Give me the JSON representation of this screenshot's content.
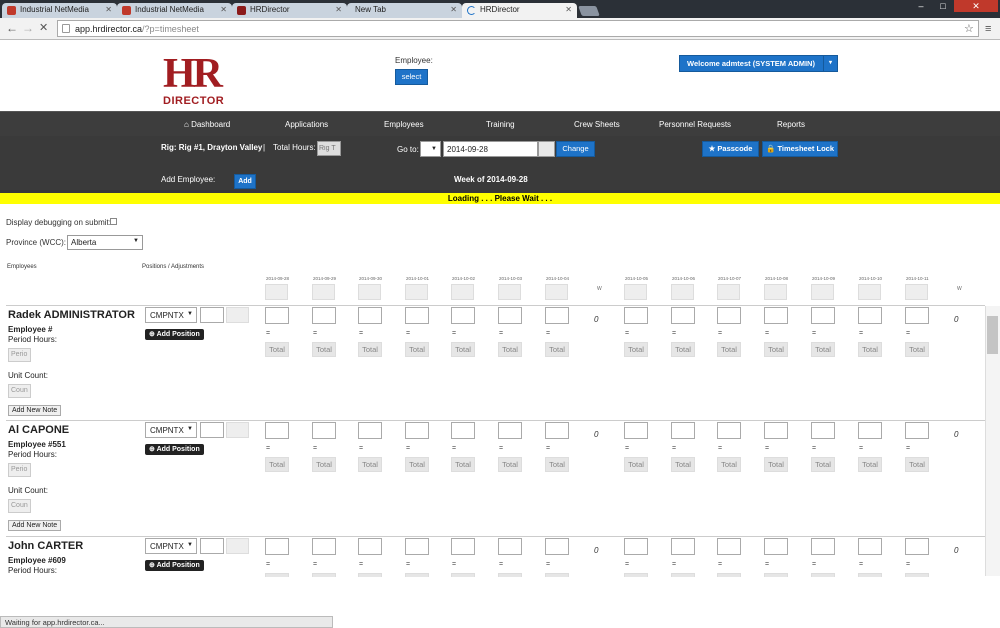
{
  "browser": {
    "tabs": [
      {
        "label": "Industrial NetMedia",
        "icon_color": "#c0392b"
      },
      {
        "label": "Industrial NetMedia",
        "icon_color": "#c0392b"
      },
      {
        "label": "HRDirector",
        "icon_color": "#8b1a1a"
      },
      {
        "label": "New Tab",
        "icon_color": ""
      },
      {
        "label": "HRDirector",
        "icon_color": "#1e73c8"
      }
    ],
    "url_host": "app.hrdirector.ca",
    "url_path": "/?p=timesheet",
    "status": "Waiting for app.hrdirector.ca..."
  },
  "header": {
    "logo_top": "HR",
    "logo_bottom": "DIRECTOR",
    "employee_label": "Employee:",
    "select_btn": "select",
    "welcome": "Welcome admtest (SYSTEM ADMIN)"
  },
  "nav": [
    "Dashboard",
    "Applications",
    "Employees",
    "Training",
    "Crew Sheets",
    "Personnel Requests",
    "Reports"
  ],
  "toolbar": {
    "rig_label": "Rig: Rig #1, Drayton Valley",
    "sep": "|",
    "total_hours_label": "Total Hours:",
    "total_hours_placeholder": "Rig T",
    "goto_label": "Go to:",
    "goto_value": "2014-09-28",
    "change_btn": "Change",
    "passcode_btn": "Passcode",
    "timesheet_lock_btn": "Timesheet Lock",
    "add_employee_label": "Add Employee:",
    "add_btn": "Add",
    "week_of": "Week of 2014-09-28"
  },
  "loading": "Loading . . . Please Wait . . .",
  "options": {
    "debug_label": "Display debugging on submit:",
    "province_label": "Province (WCC):",
    "province_value": "Alberta"
  },
  "grid": {
    "employees_header": "Employees",
    "positions_header": "Positions / Adjustments",
    "dates_week1": [
      "2014-09-28",
      "2014-09-29",
      "2014-09-30",
      "2014-10-01",
      "2014-10-02",
      "2014-10-03",
      "2014-10-04"
    ],
    "dates_week2": [
      "2014-10-05",
      "2014-10-06",
      "2014-10-07",
      "2014-10-08",
      "2014-10-09",
      "2014-10-10",
      "2014-10-11"
    ],
    "week_col": "W",
    "total_placeholder": "Total",
    "eq": "=",
    "zero": "0",
    "position_code": "CMPNTX",
    "add_position": "Add Position",
    "period_hours": "Period Hours:",
    "period_placeholder": "Perio",
    "unit_count": "Unit Count:",
    "unit_placeholder": "Coun",
    "add_note": "Add New Note"
  },
  "employees": [
    {
      "name": "Radek ADMINISTRATOR",
      "number": "Employee #"
    },
    {
      "name": "Al CAPONE",
      "number": "Employee #551"
    },
    {
      "name": "John CARTER",
      "number": "Employee #609"
    }
  ]
}
